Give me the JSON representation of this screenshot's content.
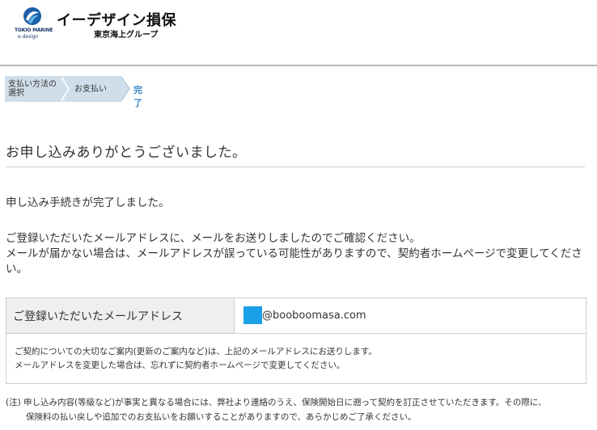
{
  "header": {
    "logo_line1": "TOKIO MARINE",
    "logo_line2": "e.design",
    "brand_name": "イーデザイン損保",
    "group_name": "東京海上グループ"
  },
  "steps": {
    "step1": "支払い方法の\n選択",
    "step2": "お支払い",
    "step3": "完了"
  },
  "main": {
    "title": "お申し込みありがとうございました。",
    "message1": "申し込み手続きが完了しました。",
    "message2": "ご登録いただいたメールアドレスに、メールをお送りしましたのでご確認ください。\nメールが届かない場合は、メールアドレスが誤っている可能性がありますので、契約者ホームページで変更してください。"
  },
  "email_box": {
    "label": "ご登録いただいたメールアドレス",
    "email_domain": "@booboomasa.com",
    "note": "ご契約についての大切なご案内(更新のご案内など)は、上記のメールアドレスにお送りします。\nメールアドレスを変更した場合は、忘れずに契約者ホームページで変更してください。"
  },
  "footnote": {
    "line1": "(注) 申し込み内容(等級など)が事実と異なる場合には、弊社より連絡のうえ、保険開始日に遡って契約を訂正させていただきます。その際に、",
    "line2": "保険料の払い戻しや追加でのお支払いをお願いすることがありますので、あらかじめご了承ください。"
  },
  "colors": {
    "accent": "#3a87c8",
    "step_bg": "#cfdeea",
    "mask": "#1aa0e6"
  }
}
